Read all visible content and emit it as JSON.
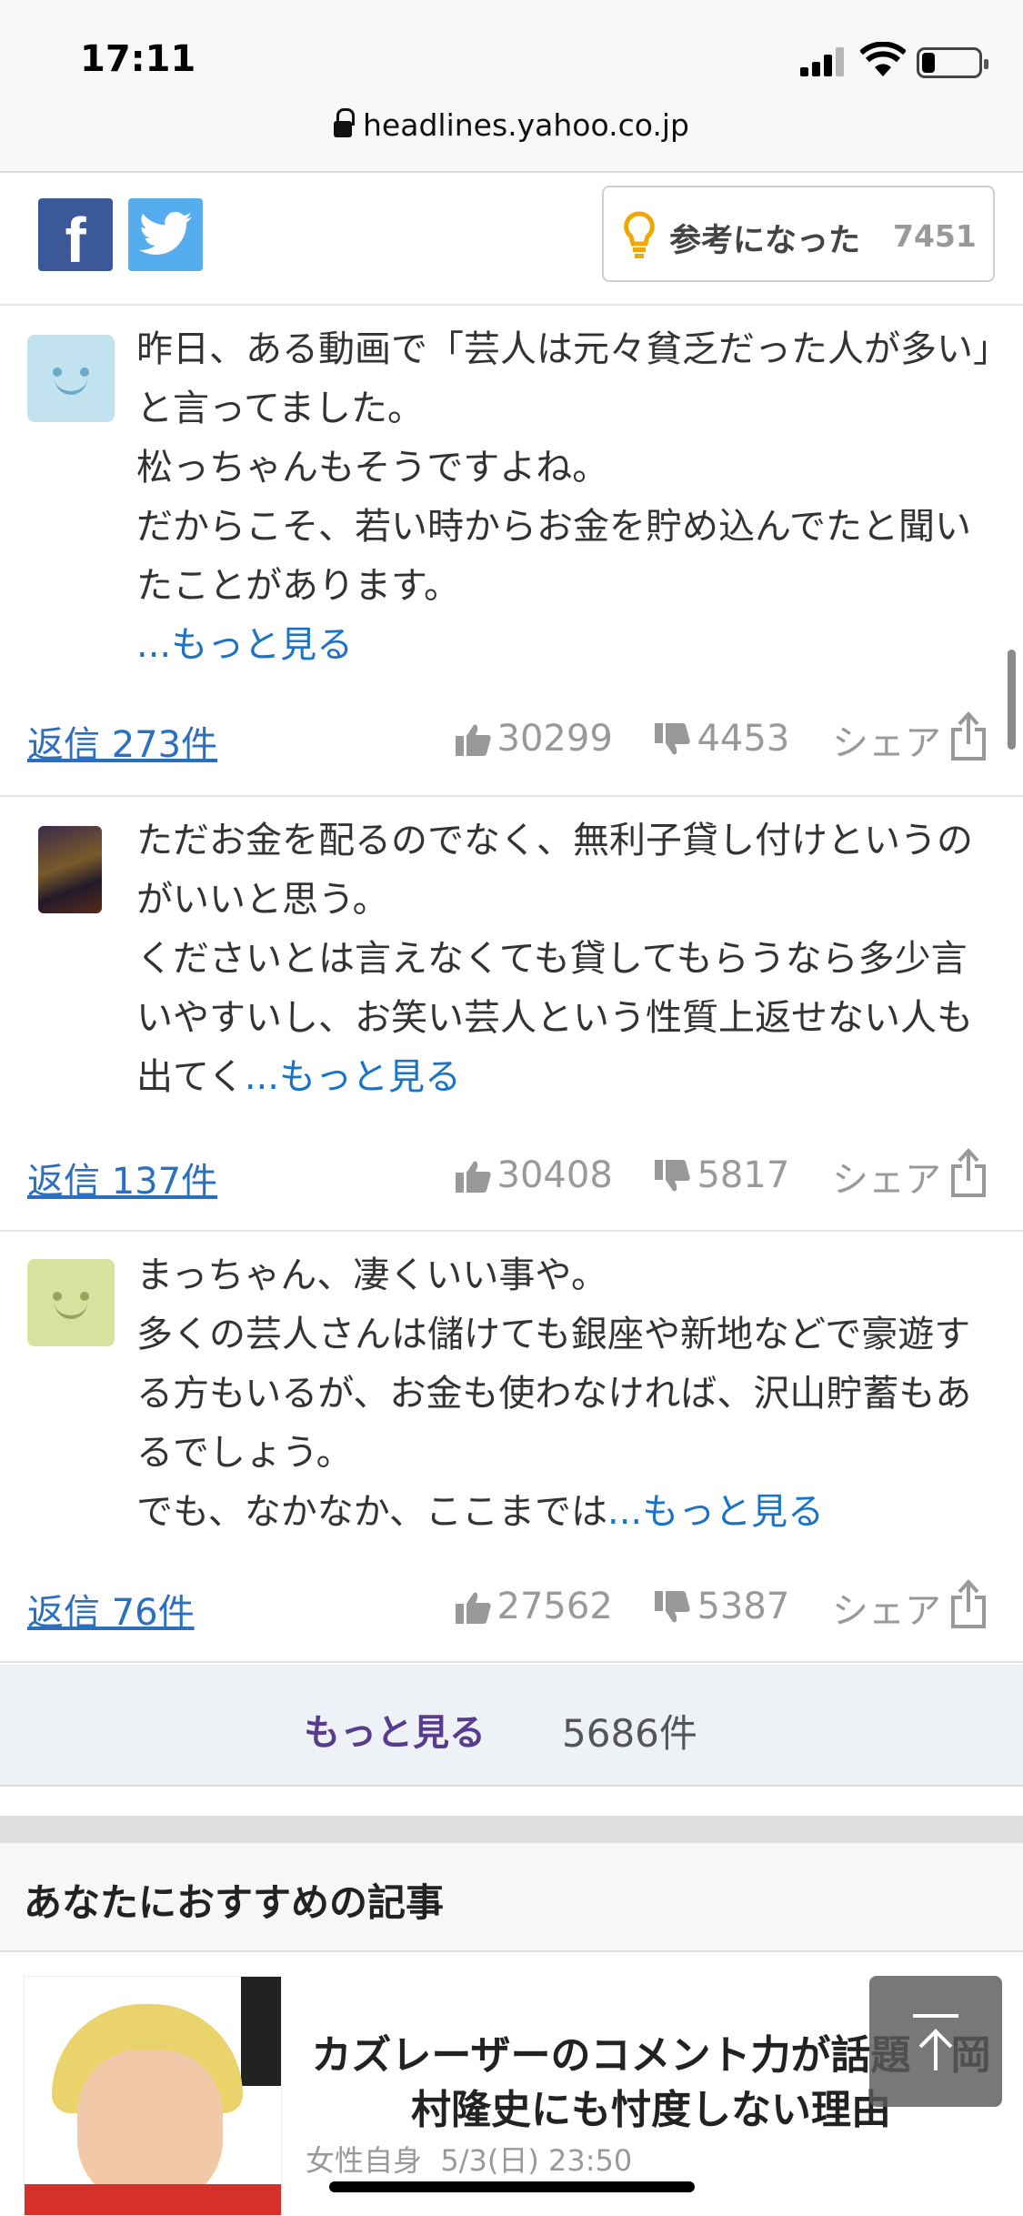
{
  "status_bar": {
    "time": "17:11",
    "url": "headlines.yahoo.co.jp"
  },
  "share": {
    "facebook_glyph": "f",
    "helpful_label": "参考になった",
    "helpful_count": "7451"
  },
  "comments": [
    {
      "avatar": "face-blue",
      "text": "昨日、ある動画で「芸人は元々貧乏だった人が多い」と言ってました。\n松っちゃんもそうですよね。\nだからこそ、若い時からお金を貯め込んでたと聞いたことがあります。",
      "more": "...もっと見る",
      "reply": "返信 273件",
      "likes": "30299",
      "dislikes": "4453",
      "share": "シェア"
    },
    {
      "avatar": "user-image",
      "text": "ただお金を配るのでなく、無利子貸し付けというのがいいと思う。\nくださいとは言えなくても貸してもらうなら多少言いやすいし、お笑い芸人という性質上返せない人も出てく",
      "more": "...もっと見る",
      "reply": "返信 137件",
      "likes": "30408",
      "dislikes": "5817",
      "share": "シェア"
    },
    {
      "avatar": "face-green",
      "text": "まっちゃん、凄くいい事や。\n多くの芸人さんは儲けても銀座や新地などで豪遊する方もいるが、お金も使わなければ、沢山貯蓄もあるでしょう。\nでも、なかなか、ここまでは",
      "more": "...もっと見る",
      "reply": "返信 76件",
      "likes": "27562",
      "dislikes": "5387",
      "share": "シェア"
    }
  ],
  "more_bar": {
    "label": "もっと見る",
    "count": "5686件"
  },
  "recommend": {
    "heading": "あなたにおすすめの記事",
    "article": {
      "title": "カズレーザーのコメント力が話題　岡村隆史にも忖度しない理由",
      "source": "女性自身",
      "date": "5/3(日) 23:50"
    }
  },
  "colors": {
    "link": "#1a73c7",
    "more": "#5a3c8e",
    "facebook": "#3b5998",
    "twitter": "#55acee"
  }
}
